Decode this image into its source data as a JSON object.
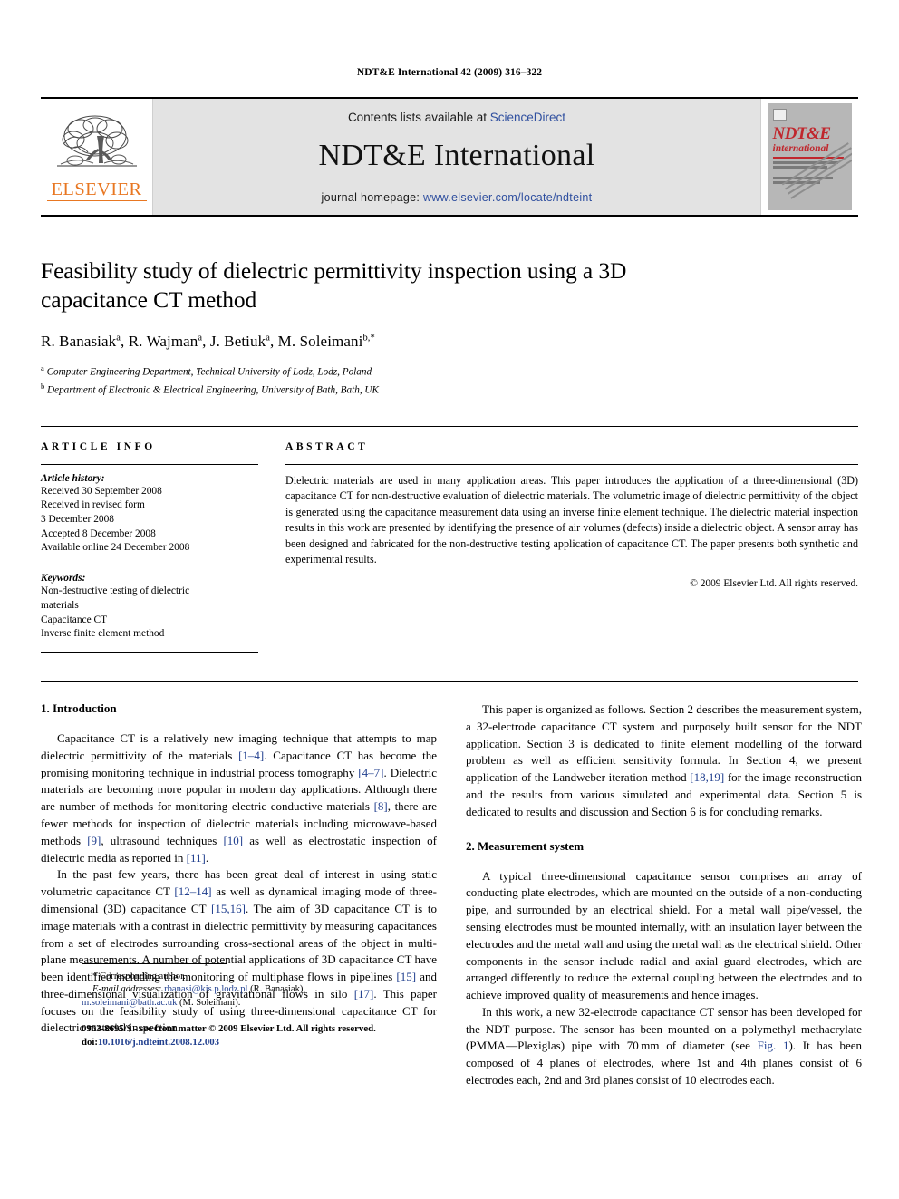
{
  "running_head": "NDT&E International 42 (2009) 316–322",
  "masthead": {
    "publisher_logo_label": "ELSEVIER",
    "contents_prefix": "Contents lists available at ",
    "contents_link": "ScienceDirect",
    "journal_title": "NDT&E International",
    "homepage_prefix": "journal homepage: ",
    "homepage_url": "www.elsevier.com/locate/ndteint",
    "cover": {
      "title_main": "NDT&E",
      "title_sub": "international"
    },
    "link_color": "#2f4f9f",
    "brand_color": "#E87722",
    "cover_accent": "#c0272d"
  },
  "article": {
    "title": "Feasibility study of dielectric permittivity inspection using a 3D capacitance CT method",
    "authors_html": "R. Banasiak<sup>a</sup>, R. Wajman<sup>a</sup>, J. Betiuk<sup>a</sup>, M. Soleimani<sup>b,*</sup>",
    "affiliations": [
      {
        "marker": "a",
        "text": "Computer Engineering Department, Technical University of Lodz, Lodz, Poland"
      },
      {
        "marker": "b",
        "text": "Department of Electronic & Electrical Engineering, University of Bath, Bath, UK"
      }
    ]
  },
  "article_info": {
    "heading": "ARTICLE INFO",
    "history_label": "Article history:",
    "history": [
      "Received 30 September 2008",
      "Received in revised form",
      "3 December 2008",
      "Accepted 8 December 2008",
      "Available online 24 December 2008"
    ],
    "keywords_label": "Keywords:",
    "keywords": [
      "Non-destructive testing of dielectric",
      "materials",
      "Capacitance CT",
      "Inverse finite element method"
    ]
  },
  "abstract": {
    "heading": "ABSTRACT",
    "text": "Dielectric materials are used in many application areas. This paper introduces the application of a three-dimensional (3D) capacitance CT for non-destructive evaluation of dielectric materials. The volumetric image of dielectric permittivity of the object is generated using the capacitance measurement data using an inverse finite element technique. The dielectric material inspection results in this work are presented by identifying the presence of air volumes (defects) inside a dielectric object. A sensor array has been designed and fabricated for the non-destructive testing application of capacitance CT. The paper presents both synthetic and experimental results.",
    "copyright": "© 2009 Elsevier Ltd. All rights reserved."
  },
  "sections": {
    "intro_heading": "1. Introduction",
    "intro_p1_a": "Capacitance CT is a relatively new imaging technique that attempts to map dielectric permittivity of the materials ",
    "intro_p1_r1": "[1–4]",
    "intro_p1_b": ". Capacitance CT has become the promising monitoring technique in industrial process tomography ",
    "intro_p1_r2": "[4–7]",
    "intro_p1_c": ". Dielectric materials are becoming more popular in modern day applications. Although there are number of methods for monitoring electric conductive materials ",
    "intro_p1_r3": "[8]",
    "intro_p1_d": ", there are fewer methods for inspection of dielectric materials including microwave-based methods ",
    "intro_p1_r4": "[9]",
    "intro_p1_e": ", ultrasound techniques ",
    "intro_p1_r5": "[10]",
    "intro_p1_f": " as well as electrostatic inspection of dielectric media as reported in ",
    "intro_p1_r6": "[11]",
    "intro_p1_g": ".",
    "intro_p2_a": "In the past few years, there has been great deal of interest in using static volumetric capacitance CT ",
    "intro_p2_r1": "[12–14]",
    "intro_p2_b": " as well as dynamical imaging mode of three-dimensional (3D) capacitance CT ",
    "intro_p2_r2": "[15,16]",
    "intro_p2_c": ". The aim of 3D capacitance CT is to image materials with a contrast in dielectric permittivity by measuring capacitances from a set of electrodes surrounding cross-sectional areas of the object in multi-plane measurements. A number of potential applications of 3D capacitance CT have been identified including the monitoring of multiphase flows in pipelines ",
    "intro_p2_r3": "[15]",
    "intro_p2_d": " and three-dimensional visualization of gravitational flows in silo ",
    "intro_p2_r4": "[17]",
    "intro_p2_e": ". This paper focuses on the feasibility study of using three-dimensional capacitance CT for dielectric material inspection.",
    "org_p_a": "This paper is organized as follows. Section 2 describes the measurement system, a 32-electrode capacitance CT system and purposely built sensor for the NDT application. Section 3 is dedicated to finite element modelling of the forward problem as well as efficient sensitivity formula. In Section 4, we present application of the Landweber iteration method ",
    "org_p_r1": "[18,19]",
    "org_p_b": " for the image reconstruction and the results from various simulated and experimental data. Section 5 is dedicated to results and discussion and Section 6 is for concluding remarks.",
    "meas_heading": "2. Measurement system",
    "meas_p1": "A typical three-dimensional capacitance sensor comprises an array of conducting plate electrodes, which are mounted on the outside of a non-conducting pipe, and surrounded by an electrical shield. For a metal wall pipe/vessel, the sensing electrodes must be mounted internally, with an insulation layer between the electrodes and the metal wall and using the metal wall as the electrical shield. Other components in the sensor include radial and axial guard electrodes, which are arranged differently to reduce the external coupling between the electrodes and to achieve improved quality of measurements and hence images.",
    "meas_p2_a": "In this work, a new 32-electrode capacitance CT sensor has been developed for the NDT purpose. The sensor has been mounted on a polymethyl methacrylate (PMMA—Plexiglas) pipe with 70 mm of diameter (see ",
    "meas_p2_r1": "Fig. 1",
    "meas_p2_b": "). It has been composed of 4 planes of electrodes, where 1st and 4th planes consist of 6 electrodes each, 2nd and 3rd planes consist of 10 electrodes each."
  },
  "footnote": {
    "corresponding": "* Corresponding author.",
    "email_label": "E-mail addresses:",
    "email1": "rbanasi@kis.p.lodz.pl",
    "email1_owner": "(R. Banasiak),",
    "email2": "m.soleimani@bath.ac.uk",
    "email2_owner": "(M. Soleimani).",
    "imprint": "0963-8695/$ - see front matter © 2009 Elsevier Ltd. All rights reserved.",
    "doi_label": "doi:",
    "doi": "10.1016/j.ndteint.2008.12.003"
  }
}
